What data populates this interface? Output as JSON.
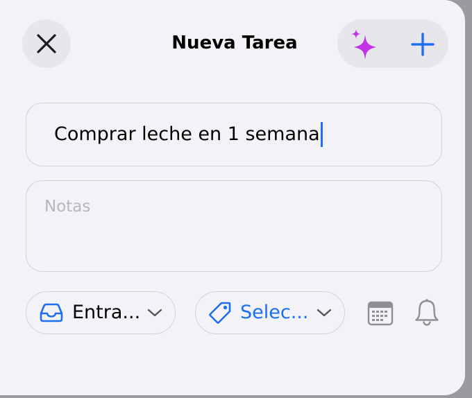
{
  "header": {
    "title": "Nueva Tarea",
    "close_icon": "close-icon",
    "sparkle_icon": "sparkles-icon",
    "add_icon": "plus-icon"
  },
  "form": {
    "task_title": "Comprar leche en 1 semana",
    "notes_placeholder": "Notas"
  },
  "toolbar": {
    "list_label": "Entra...",
    "tag_label": "Selec...",
    "calendar_icon": "calendar-icon",
    "reminder_icon": "bell-icon"
  },
  "colors": {
    "accent": "#1c6ef2",
    "sparkle": "#c233e6",
    "background": "#f2f2f7",
    "control_bg": "#e6e6eb"
  }
}
